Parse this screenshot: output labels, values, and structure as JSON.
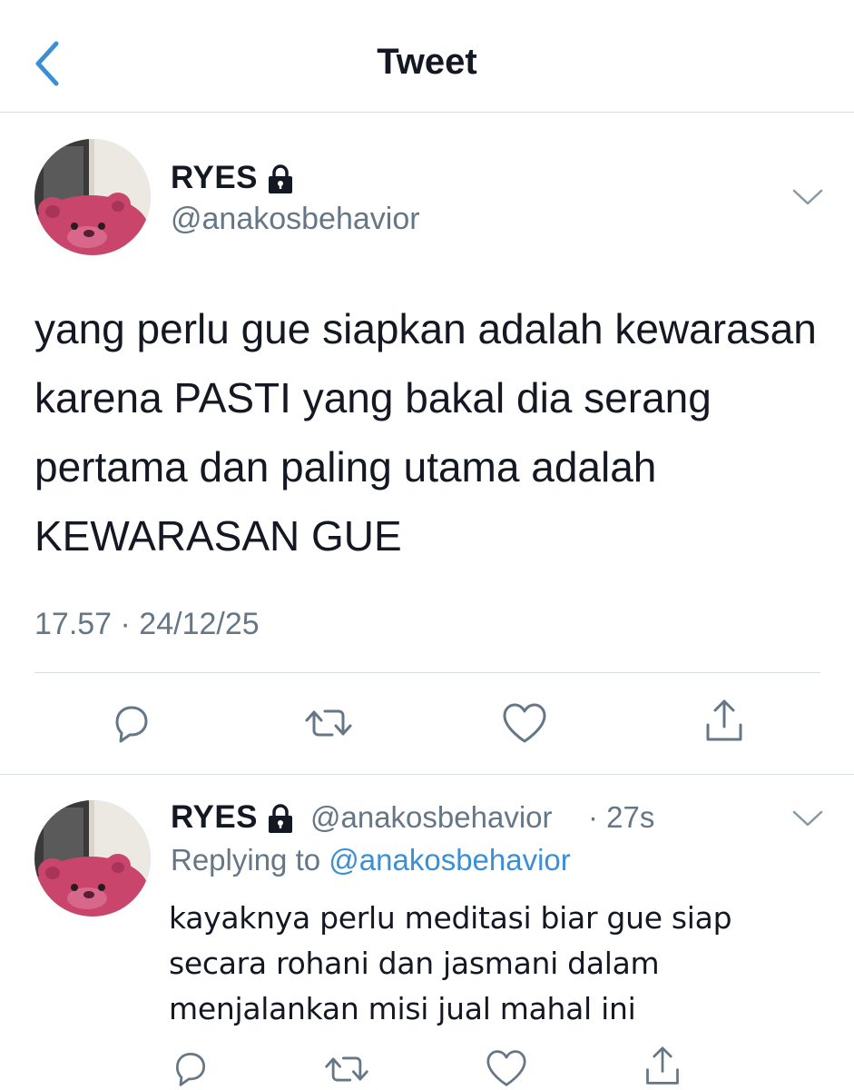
{
  "header": {
    "title": "Tweet",
    "back_icon": "chevron-left-icon",
    "accent_color": "#1da1f2"
  },
  "tweet": {
    "name": "RYES",
    "handle": "@anakosbehavior",
    "protected_icon": "lock-icon",
    "text": "yang perlu gue siapkan adalah kewarasan karena PASTI yang bakal dia serang pertama dan paling utama adalah KEWARASAN GUE",
    "timestamp": "17.57 · 24/12/25",
    "actions": [
      "reply-icon",
      "retweet-icon",
      "like-icon",
      "share-icon"
    ]
  },
  "reply": {
    "name": "RYES",
    "handle": "@anakosbehavior",
    "time": "· 27s",
    "replying_prefix": "Replying to",
    "replying_handle": "@anakosbehavior",
    "text": "kayaknya perlu meditasi biar gue siap secara rohani dan jasmani dalam menjalankan misi jual mahal ini",
    "actions": [
      "reply-icon",
      "retweet-icon",
      "like-icon",
      "share-icon"
    ]
  },
  "colors": {
    "text": "#141823",
    "secondary": "#657786",
    "link": "#3b8fd6",
    "divider": "#d8dde2"
  }
}
